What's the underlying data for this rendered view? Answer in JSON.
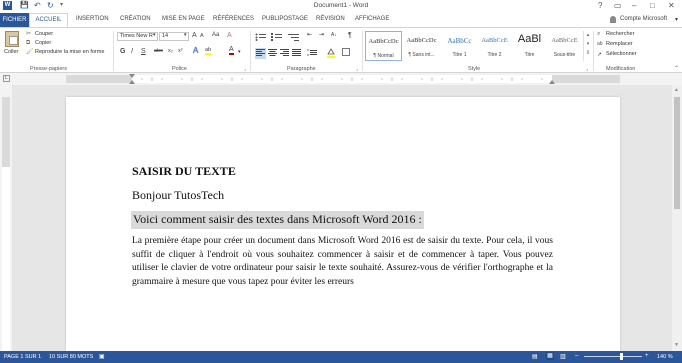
{
  "window": {
    "title": "Document1 - Word"
  },
  "qat": {
    "icon_app": "W",
    "save": "💾",
    "undo": "↶",
    "redo": "↻",
    "custom": "▾"
  },
  "window_controls": {
    "help": "?",
    "ribbon": "▭",
    "min": "–",
    "max": "□",
    "close": "✕"
  },
  "tabs": [
    "FICHIER",
    "ACCUEIL",
    "INSERTION",
    "CRÉATION",
    "MISE EN PAGE",
    "RÉFÉRENCES",
    "PUBLIPOSTAGE",
    "RÉVISION",
    "AFFICHAGE"
  ],
  "account": {
    "label": "Compte Microsoft",
    "arrow": "▾"
  },
  "clipboard": {
    "paste": "Coller",
    "cut": "Couper",
    "copy": "Copier",
    "format_painter": "Reproduire la mise en forme",
    "group": "Presse-papiers"
  },
  "font": {
    "name": "Times New R",
    "size": "14",
    "group": "Police",
    "grow": "A",
    "shrink": "A",
    "case": "Aa",
    "clear": "A",
    "bold": "G",
    "italic": "I",
    "underline": "S",
    "strike": "abc",
    "sub": "x₂",
    "sup": "x²",
    "effects": "A",
    "highlight": "ab",
    "color": "A"
  },
  "paragraph": {
    "group": "Paragraphe",
    "show": "¶",
    "sort": "A↓",
    "indent_dec": "⇤",
    "indent_inc": "⇥"
  },
  "styles": {
    "group": "Style",
    "items": [
      {
        "sample": "AaBbCcDc",
        "name": "¶ Normal"
      },
      {
        "sample": "AaBbCcDc",
        "name": "¶ Sans int..."
      },
      {
        "sample": "AaBbCc",
        "name": "Titre 1"
      },
      {
        "sample": "AaBbCcE",
        "name": "Titre 2"
      },
      {
        "sample": "AaBl",
        "name": "Titre"
      },
      {
        "sample": "AaBbCcE",
        "name": "Sous-titre"
      }
    ]
  },
  "editing": {
    "find": "Rechercher",
    "replace": "Remplacer",
    "select": "Sélectionner",
    "group": "Modification"
  },
  "document": {
    "heading": "SAISIR DU TEXTE",
    "greeting": "Bonjour TutosTech",
    "selected_line": "Voici comment saisir des textes dans Microsoft Word 2016 :",
    "paragraph": "La première étape pour créer un document dans Microsoft Word 2016 est de saisir du texte. Pour cela, il vous suffit de cliquer à l'endroit où vous souhaitez commencer à saisir et de commencer à taper. Vous pouvez utiliser le clavier de votre ordinateur pour saisir le texte souhaité. Assurez-vous de vérifier l'orthographe et la grammaire à mesure que vous tapez pour éviter les erreurs"
  },
  "status": {
    "page": "PAGE 1 SUR 1",
    "words": "10 SUR 80 MOTS",
    "zoom": "140 %"
  },
  "colors": {
    "accent": "#2b579a",
    "selection": "#d9d9d9",
    "font_color": "#c00000",
    "highlight": "#ffff00"
  }
}
